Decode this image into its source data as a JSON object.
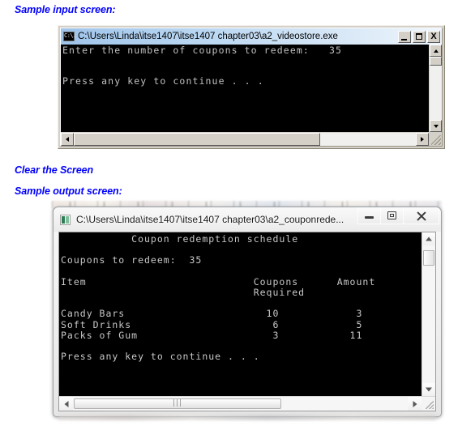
{
  "captions": {
    "input": "Sample input screen:",
    "clear": "Clear the Screen",
    "output": "Sample output screen:"
  },
  "colors": {
    "caption_blue": "#0000FF",
    "console_bg": "#000000",
    "console_fg": "#C0C0C0",
    "win1_titlebar": "#BCD8F2"
  },
  "window_input": {
    "title": "C:\\Users\\Linda\\itse1407\\itse1407 chapter03\\a2_videostore.exe",
    "icon": "console-icon",
    "buttons": {
      "minimize": "minimize-button",
      "maximize": "maximize-button",
      "close": "close-button",
      "close_glyph": "X"
    },
    "console_text": "Enter the number of coupons to redeem:   35\n\n\nPress any key to continue . . .",
    "lines": [
      "Enter the number of coupons to redeem:   35",
      "",
      "",
      "Press any key to continue . . ."
    ],
    "prompt_label": "Enter the number of coupons to redeem:",
    "prompt_value": "35",
    "continue_text": "Press any key to continue . . ."
  },
  "window_output": {
    "title": "C:\\Users\\Linda\\itse1407\\itse1407 chapter03\\a2_couponrede...",
    "icon": "console-icon",
    "buttons": {
      "minimize": "minimize-button",
      "restore": "restore-button",
      "close": "close-button"
    },
    "console_text": "           Coupon redemption schedule\n\nCoupons to redeem:  35\n\nItem                          Coupons      Amount\n                              Required\n\nCandy Bars                      10            3\nSoft Drinks                      6            5\nPacks of Gum                     3           11\n\nPress any key to continue . . .",
    "report_title": "Coupon redemption schedule",
    "coupons_label": "Coupons to redeem:",
    "coupons_value": "35",
    "headers": [
      "Item",
      "Coupons Required",
      "Amount"
    ],
    "rows": [
      {
        "item": "Candy Bars",
        "coupons_required": "10",
        "amount": "3"
      },
      {
        "item": "Soft Drinks",
        "coupons_required": "6",
        "amount": "5"
      },
      {
        "item": "Packs of Gum",
        "coupons_required": "3",
        "amount": "11"
      }
    ],
    "continue_text": "Press any key to continue . . ."
  }
}
